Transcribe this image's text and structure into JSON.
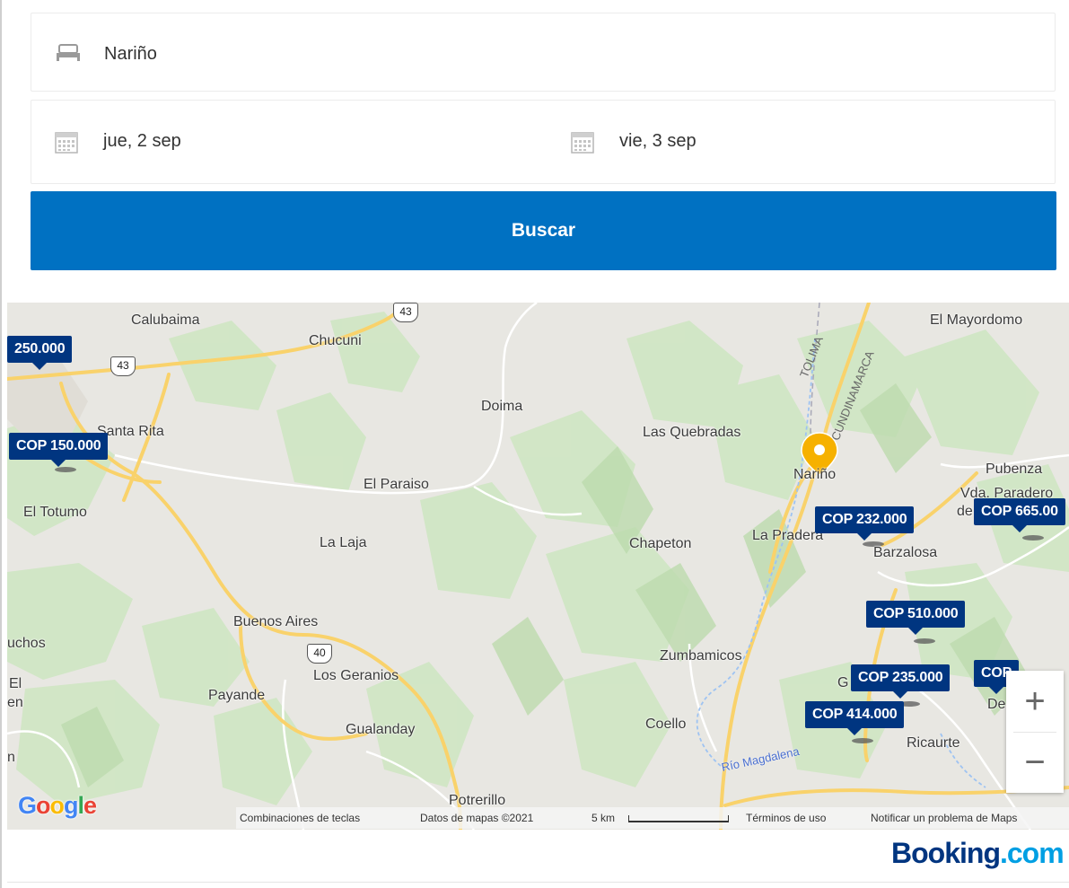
{
  "search": {
    "destination": "Nariño",
    "checkin": "jue, 2 sep",
    "checkout": "vie, 3 sep",
    "button": "Buscar"
  },
  "map": {
    "places": [
      {
        "name": "Calubaima"
      },
      {
        "name": "Chucuni"
      },
      {
        "name": "Doima"
      },
      {
        "name": "Las Quebradas"
      },
      {
        "name": "El Mayordomo"
      },
      {
        "name": "Santa Rita"
      },
      {
        "name": "El Paraiso"
      },
      {
        "name": "Nariño"
      },
      {
        "name": "Pubenza"
      },
      {
        "name": "Vda. Paradero"
      },
      {
        "name": "de"
      },
      {
        "name": "El Totumo"
      },
      {
        "name": "La Laja"
      },
      {
        "name": "Chapeton"
      },
      {
        "name": "La Pradera"
      },
      {
        "name": "Barzalosa"
      },
      {
        "name": "Buenos Aires"
      },
      {
        "name": "uchos"
      },
      {
        "name": "Zumbamicos"
      },
      {
        "name": "El"
      },
      {
        "name": "en"
      },
      {
        "name": "Los Geranios"
      },
      {
        "name": "Payande"
      },
      {
        "name": "G"
      },
      {
        "name": "De"
      },
      {
        "name": "Gualanday"
      },
      {
        "name": "Coello"
      },
      {
        "name": "Ricaurte"
      },
      {
        "name": "n"
      },
      {
        "name": "Potrerillo"
      }
    ],
    "regions": [
      "TOLIMA",
      "CUNDINAMARCA"
    ],
    "river": "Río Magdalena",
    "road_shields": [
      "43",
      "43",
      "40"
    ],
    "prices": [
      "250.000",
      "COP 150.000",
      "COP 232.000",
      "COP 665.00",
      "COP 510.000",
      "COP 235.000",
      "COP 414.000",
      "COP"
    ],
    "zoom_in": "+",
    "zoom_out": "−",
    "google": [
      "G",
      "o",
      "o",
      "g",
      "l",
      "e"
    ],
    "attribution": {
      "shortcuts": "Combinaciones de teclas",
      "data": "Datos de mapas ©2021",
      "scale": "5 km",
      "terms": "Términos de uso",
      "report": "Notificar un problema de Maps"
    },
    "colors": {
      "price_bg": "#003580",
      "pin": "#f6b100",
      "road": "#f9d26b"
    }
  },
  "brand": {
    "name": "Booking",
    "suffix": ".com"
  }
}
